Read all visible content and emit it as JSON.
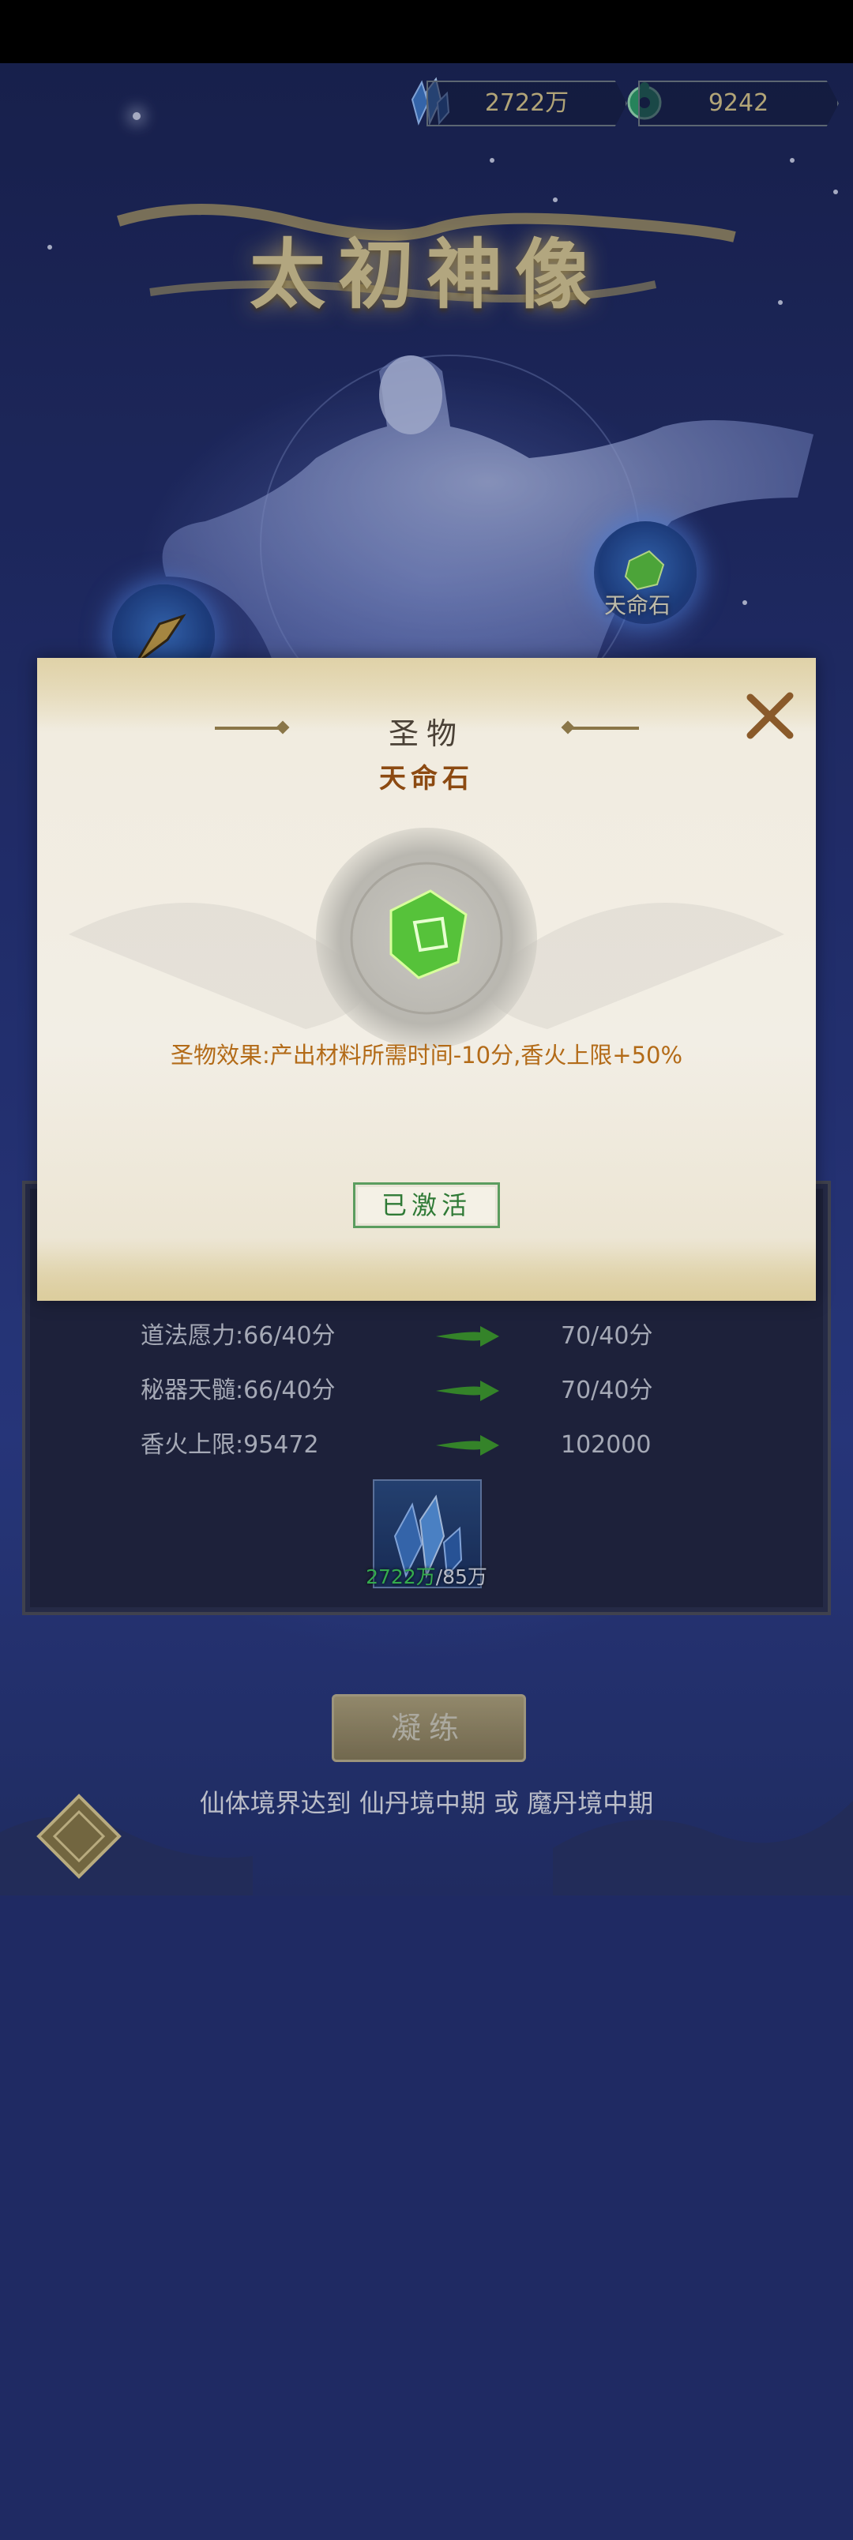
{
  "header": {
    "crystal_amount": "2722万",
    "jade_amount": "9242"
  },
  "page": {
    "title": "太初神像",
    "orb_right_label": "天命石"
  },
  "panel": {
    "rows": [
      {
        "label": "道法愿力:66/40分",
        "next": "70/40分"
      },
      {
        "label": "秘器天髓:66/40分",
        "next": "70/40分"
      },
      {
        "label": "香火上限:95472",
        "next": "102000"
      }
    ],
    "cost_have": "2722万",
    "cost_need": "/85万"
  },
  "refine_button": "凝练",
  "requirement_text": "仙体境界达到 仙丹境中期 或 魔丹境中期",
  "modal": {
    "title": "圣物",
    "item_name": "天命石",
    "effect": "圣物效果:产出材料所需时间-10分,香火上限+50%",
    "status_button": "已激活"
  },
  "colors": {
    "effect_text": "#b36b18",
    "activated_green": "#2f7a36",
    "cost_have_green": "#3fcf5a"
  },
  "icons": {
    "crystal": "blue-crystal-icon",
    "jade": "jade-coin-icon",
    "gem": "green-gem-icon",
    "close": "close-icon"
  }
}
